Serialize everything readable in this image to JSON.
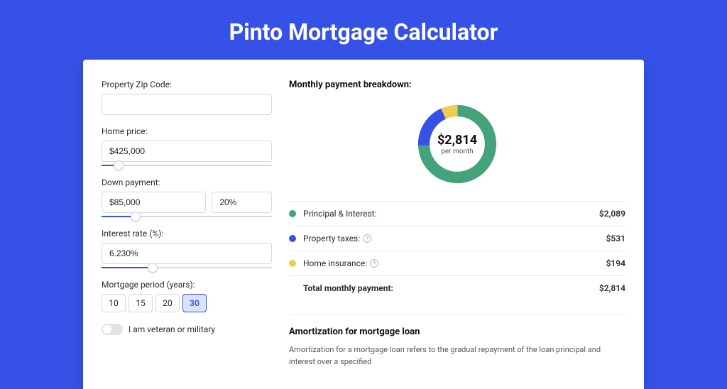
{
  "title": "Pinto Mortgage Calculator",
  "colors": {
    "principal": "#45a37b",
    "taxes": "#3652e6",
    "insurance": "#f2cc52"
  },
  "form": {
    "zip": {
      "label": "Property Zip Code:",
      "value": ""
    },
    "home_price": {
      "label": "Home price:",
      "value": "$425,000",
      "slider_percent": 10
    },
    "down_payment": {
      "label": "Down payment:",
      "amount": "$85,000",
      "percent": "20%",
      "slider_percent": 20
    },
    "interest_rate": {
      "label": "Interest rate (%):",
      "value": "6.230%",
      "slider_percent": 30
    },
    "period": {
      "label": "Mortgage period (years):",
      "options": [
        "10",
        "15",
        "20",
        "30"
      ],
      "selected": "30"
    },
    "veteran": {
      "label": "I am veteran or military",
      "checked": false
    }
  },
  "breakdown": {
    "title": "Monthly payment breakdown:",
    "center_amount": "$2,814",
    "center_sub": "per month",
    "items": [
      {
        "label": "Principal & Interest:",
        "value": "$2,089",
        "numeric": 2089,
        "color_key": "principal",
        "has_info": false
      },
      {
        "label": "Property taxes:",
        "value": "$531",
        "numeric": 531,
        "color_key": "taxes",
        "has_info": true
      },
      {
        "label": "Home insurance:",
        "value": "$194",
        "numeric": 194,
        "color_key": "insurance",
        "has_info": true
      }
    ],
    "total_label": "Total monthly payment:",
    "total_value": "$2,814"
  },
  "chart_data": {
    "type": "pie",
    "title": "Monthly payment breakdown",
    "series": [
      {
        "name": "Principal & Interest",
        "value": 2089
      },
      {
        "name": "Property taxes",
        "value": 531
      },
      {
        "name": "Home insurance",
        "value": 194
      }
    ],
    "total": 2814,
    "center_label": "$2,814 per month"
  },
  "amortization": {
    "title": "Amortization for mortgage loan",
    "body": "Amortization for a mortgage loan refers to the gradual repayment of the loan principal and interest over a specified"
  }
}
